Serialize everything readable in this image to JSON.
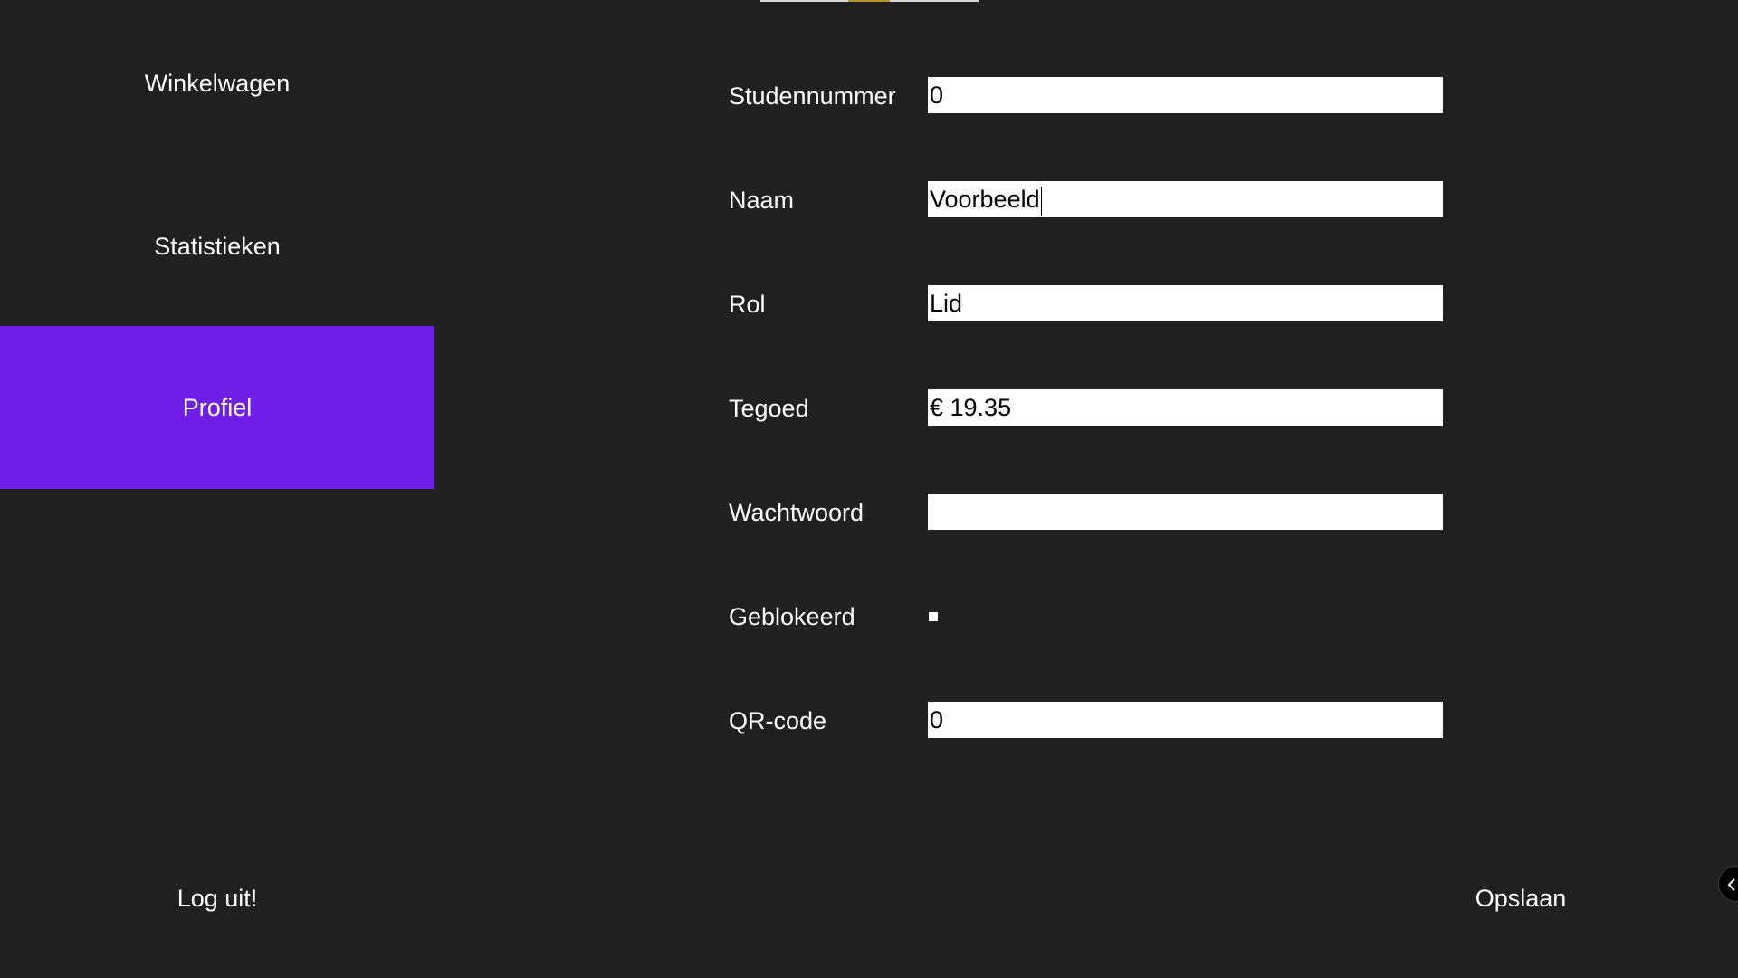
{
  "sidebar": {
    "items": [
      {
        "label": "Winkelwagen",
        "active": false
      },
      {
        "label": "Statistieken",
        "active": false
      },
      {
        "label": "Profiel",
        "active": true
      }
    ],
    "logout_label": "Log uit!"
  },
  "form": {
    "studentnummer": {
      "label": "Studennummer",
      "value": "0"
    },
    "naam": {
      "label": "Naam",
      "value": "Voorbeeld"
    },
    "rol": {
      "label": "Rol",
      "value": "Lid"
    },
    "tegoed": {
      "label": "Tegoed",
      "value": "€ 19.35"
    },
    "wachtwoord": {
      "label": "Wachtwoord",
      "value": ""
    },
    "geblokkeerd": {
      "label": "Geblokeerd",
      "checked": false
    },
    "qrcode": {
      "label": "QR-code",
      "value": "0"
    }
  },
  "actions": {
    "save_label": "Opslaan"
  },
  "colors": {
    "background": "#202020",
    "accent": "#6f1ee8",
    "text": "#ffffff"
  }
}
